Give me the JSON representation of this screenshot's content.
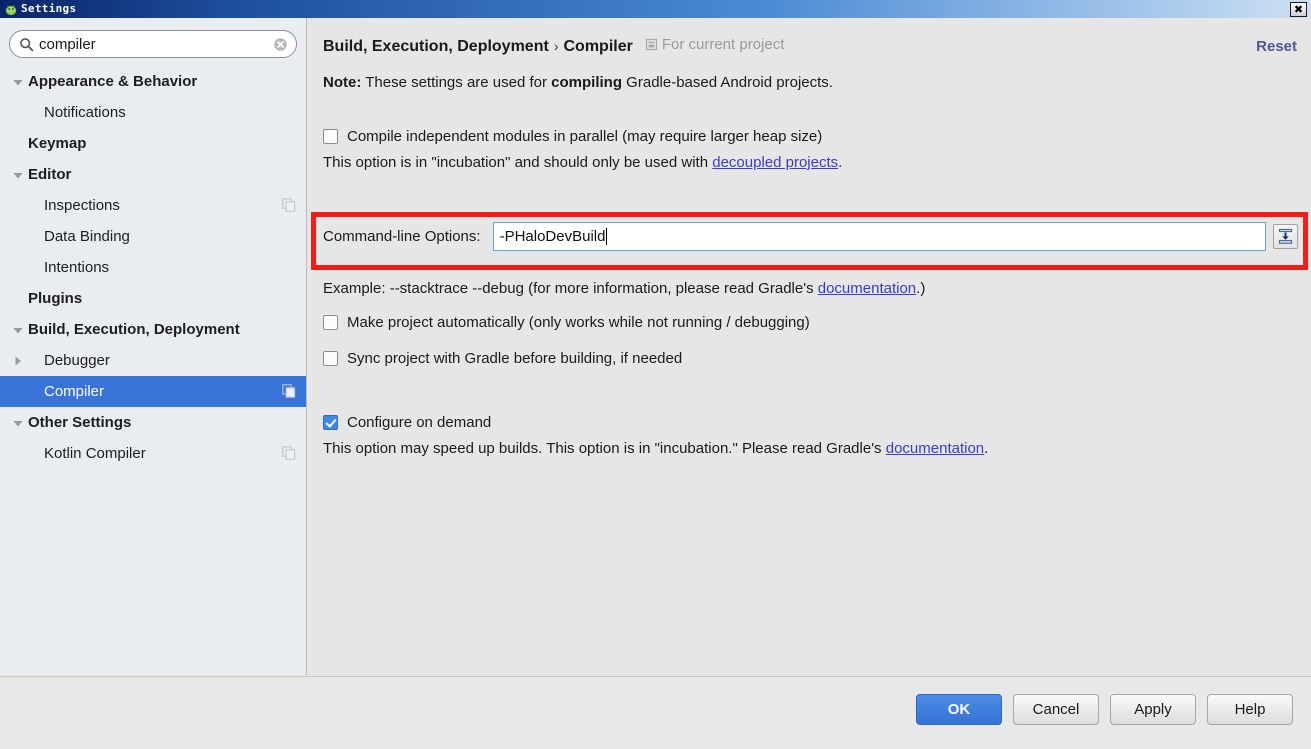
{
  "window": {
    "title": "Settings",
    "app_icon": "android-studio-icon",
    "close_label": "✖"
  },
  "sidebar": {
    "search": {
      "value": "compiler",
      "placeholder": "Search settings",
      "icon": "search-icon",
      "clear_icon": "clear-icon"
    },
    "items": [
      {
        "label": "Appearance & Behavior",
        "bold": true,
        "indent": 0,
        "arrow": "expanded",
        "badge": false,
        "selected": false
      },
      {
        "label": "Notifications",
        "bold": false,
        "indent": 1,
        "arrow": "none",
        "badge": false,
        "selected": false
      },
      {
        "label": "Keymap",
        "bold": true,
        "indent": 0,
        "arrow": "none",
        "badge": false,
        "selected": false
      },
      {
        "label": "Editor",
        "bold": true,
        "indent": 0,
        "arrow": "expanded",
        "badge": false,
        "selected": false
      },
      {
        "label": "Inspections",
        "bold": false,
        "indent": 1,
        "arrow": "none",
        "badge": true,
        "selected": false
      },
      {
        "label": "Data Binding",
        "bold": false,
        "indent": 1,
        "arrow": "none",
        "badge": false,
        "selected": false
      },
      {
        "label": "Intentions",
        "bold": false,
        "indent": 1,
        "arrow": "none",
        "badge": false,
        "selected": false
      },
      {
        "label": "Plugins",
        "bold": true,
        "indent": 0,
        "arrow": "none",
        "badge": false,
        "selected": false
      },
      {
        "label": "Build, Execution, Deployment",
        "bold": true,
        "indent": 0,
        "arrow": "expanded",
        "badge": false,
        "selected": false
      },
      {
        "label": "Debugger",
        "bold": false,
        "indent": 1,
        "arrow": "collapsed",
        "badge": false,
        "selected": false
      },
      {
        "label": "Compiler",
        "bold": false,
        "indent": 1,
        "arrow": "none",
        "badge": true,
        "selected": true
      },
      {
        "label": "Other Settings",
        "bold": true,
        "indent": 0,
        "arrow": "expanded",
        "badge": false,
        "selected": false
      },
      {
        "label": "Kotlin Compiler",
        "bold": false,
        "indent": 1,
        "arrow": "none",
        "badge": true,
        "selected": false
      }
    ]
  },
  "main": {
    "breadcrumb_parent": "Build, Execution, Deployment",
    "breadcrumb_sep": "›",
    "breadcrumb_current": "Compiler",
    "scope_label": "For current project",
    "scope_icon": "project-scope-icon",
    "reset_label": "Reset",
    "note_prefix": "Note:",
    "note_text_1": " These settings are used for ",
    "note_bold": "compiling",
    "note_text_2": " Gradle-based Android projects.",
    "option_parallel": {
      "label": "Compile independent modules in parallel (may require larger heap size)",
      "checked": false,
      "hint_before": "This option is in \"incubation\" and should only be used with ",
      "hint_link": "decoupled projects",
      "hint_after": "."
    },
    "command_line": {
      "label": "Command-line Options:",
      "value": "-PHaloDevBuild",
      "placeholder": "",
      "expand_button_icon": "insert-macro-icon",
      "example_before": "Example: --stacktrace --debug (for more information, please read Gradle's ",
      "example_link": "documentation",
      "example_after": ".)"
    },
    "option_make_auto": {
      "label": "Make project automatically (only works while not running / debugging)",
      "checked": false
    },
    "option_sync_gradle": {
      "label": "Sync project with Gradle before building, if needed",
      "checked": false
    },
    "option_configure_on_demand": {
      "label": "Configure on demand",
      "checked": true,
      "hint_before": "This option may speed up builds. This option is in \"incubation.\" Please read Gradle's ",
      "hint_link": "documentation",
      "hint_after": "."
    },
    "highlight_color": "#f41c16"
  },
  "footer": {
    "buttons": [
      {
        "label": "OK",
        "primary": true
      },
      {
        "label": "Cancel",
        "primary": false
      },
      {
        "label": "Apply",
        "primary": false
      },
      {
        "label": "Help",
        "primary": false
      }
    ]
  }
}
